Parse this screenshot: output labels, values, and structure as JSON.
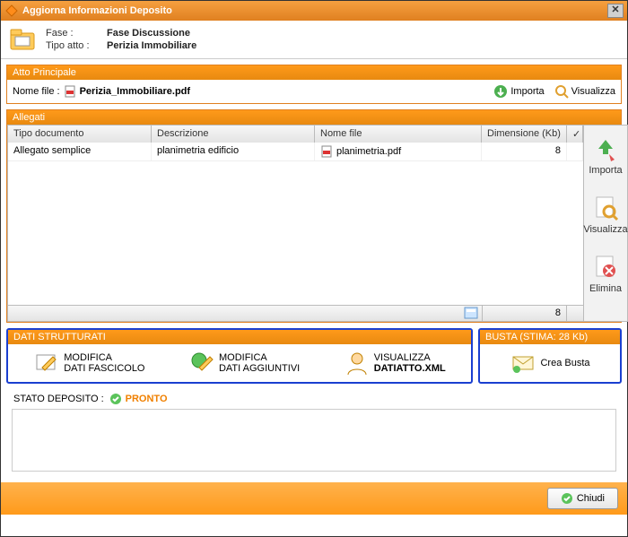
{
  "window": {
    "title": "Aggiorna Informazioni Deposito"
  },
  "header": {
    "fase_label": "Fase :",
    "fase": "Fase Discussione",
    "tipo_label": "Tipo atto :",
    "tipo": "Perizia Immobiliare"
  },
  "atto": {
    "panel_title": "Atto Principale",
    "file_label": "Nome file :",
    "file_name": "Perizia_Immobiliare.pdf",
    "importa": "Importa",
    "visualizza": "Visualizza"
  },
  "allegati": {
    "panel_title": "Allegati",
    "columns": {
      "tipo": "Tipo documento",
      "descr": "Descrizione",
      "nome": "Nome file",
      "dim": "Dimensione (Kb)"
    },
    "rows": [
      {
        "tipo": "Allegato semplice",
        "descr": "planimetria edificio",
        "nome": "planimetria.pdf",
        "dim": "8"
      }
    ],
    "footer_count": "8",
    "side": {
      "importa": "Importa",
      "visualizza": "Visualizza",
      "elimina": "Elimina"
    }
  },
  "dati": {
    "panel_title": "DATI STRUTTURATI",
    "actions": {
      "a1_l1": "MODIFICA",
      "a1_l2": "DATI FASCICOLO",
      "a2_l1": "MODIFICA",
      "a2_l2": "DATI AGGIUNTIVI",
      "a3_l1": "VISUALIZZA",
      "a3_l2": "DATIATTO.XML"
    }
  },
  "busta": {
    "panel_title": "BUSTA (STIMA: 28 Kb)",
    "crea": "Crea Busta"
  },
  "stato": {
    "label": "STATO DEPOSITO :",
    "value": "PRONTO"
  },
  "footer": {
    "chiudi": "Chiudi"
  },
  "checkmark": "✓"
}
